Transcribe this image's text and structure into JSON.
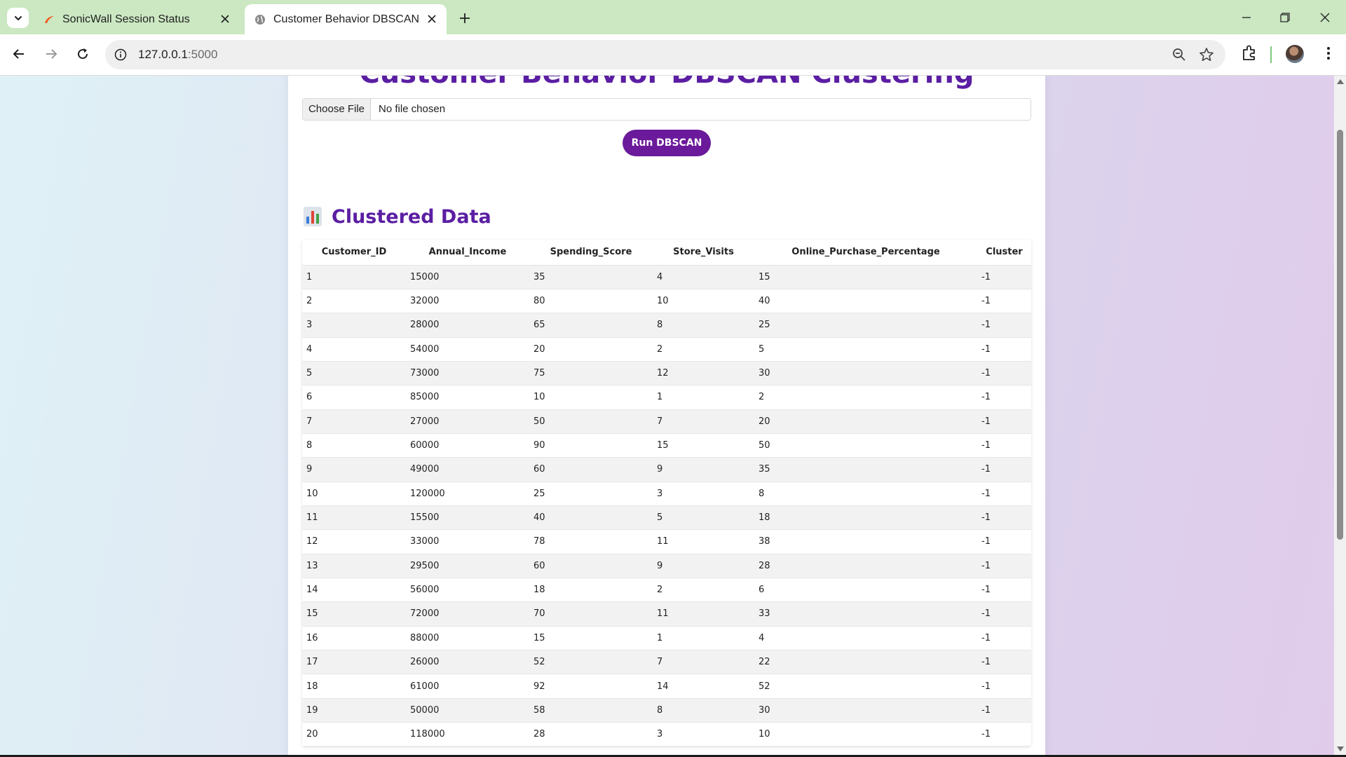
{
  "browser": {
    "tabs": [
      {
        "title": "SonicWall Session Status",
        "active": false
      },
      {
        "title": "Customer Behavior DBSCAN",
        "active": true
      }
    ],
    "url_host": "127.0.0.1",
    "url_port": ":5000"
  },
  "page": {
    "title": "Customer Behavior DBSCAN Clustering",
    "file_button_label": "Choose File",
    "file_status": "No file chosen",
    "run_button_label": "Run DBSCAN",
    "section_title": "Clustered Data"
  },
  "table": {
    "columns": [
      "Customer_ID",
      "Annual_Income",
      "Spending_Score",
      "Store_Visits",
      "Online_Purchase_Percentage",
      "Cluster"
    ],
    "rows": [
      [
        "1",
        "15000",
        "35",
        "4",
        "15",
        "-1"
      ],
      [
        "2",
        "32000",
        "80",
        "10",
        "40",
        "-1"
      ],
      [
        "3",
        "28000",
        "65",
        "8",
        "25",
        "-1"
      ],
      [
        "4",
        "54000",
        "20",
        "2",
        "5",
        "-1"
      ],
      [
        "5",
        "73000",
        "75",
        "12",
        "30",
        "-1"
      ],
      [
        "6",
        "85000",
        "10",
        "1",
        "2",
        "-1"
      ],
      [
        "7",
        "27000",
        "50",
        "7",
        "20",
        "-1"
      ],
      [
        "8",
        "60000",
        "90",
        "15",
        "50",
        "-1"
      ],
      [
        "9",
        "49000",
        "60",
        "9",
        "35",
        "-1"
      ],
      [
        "10",
        "120000",
        "25",
        "3",
        "8",
        "-1"
      ],
      [
        "11",
        "15500",
        "40",
        "5",
        "18",
        "-1"
      ],
      [
        "12",
        "33000",
        "78",
        "11",
        "38",
        "-1"
      ],
      [
        "13",
        "29500",
        "60",
        "9",
        "28",
        "-1"
      ],
      [
        "14",
        "56000",
        "18",
        "2",
        "6",
        "-1"
      ],
      [
        "15",
        "72000",
        "70",
        "11",
        "33",
        "-1"
      ],
      [
        "16",
        "88000",
        "15",
        "1",
        "4",
        "-1"
      ],
      [
        "17",
        "26000",
        "52",
        "7",
        "22",
        "-1"
      ],
      [
        "18",
        "61000",
        "92",
        "14",
        "52",
        "-1"
      ],
      [
        "19",
        "50000",
        "58",
        "8",
        "30",
        "-1"
      ],
      [
        "20",
        "118000",
        "28",
        "3",
        "10",
        "-1"
      ]
    ]
  },
  "colors": {
    "tabbar_bg": "#cbe8c2",
    "accent_purple": "#5b1ea3",
    "run_button": "#6a1a9a"
  }
}
